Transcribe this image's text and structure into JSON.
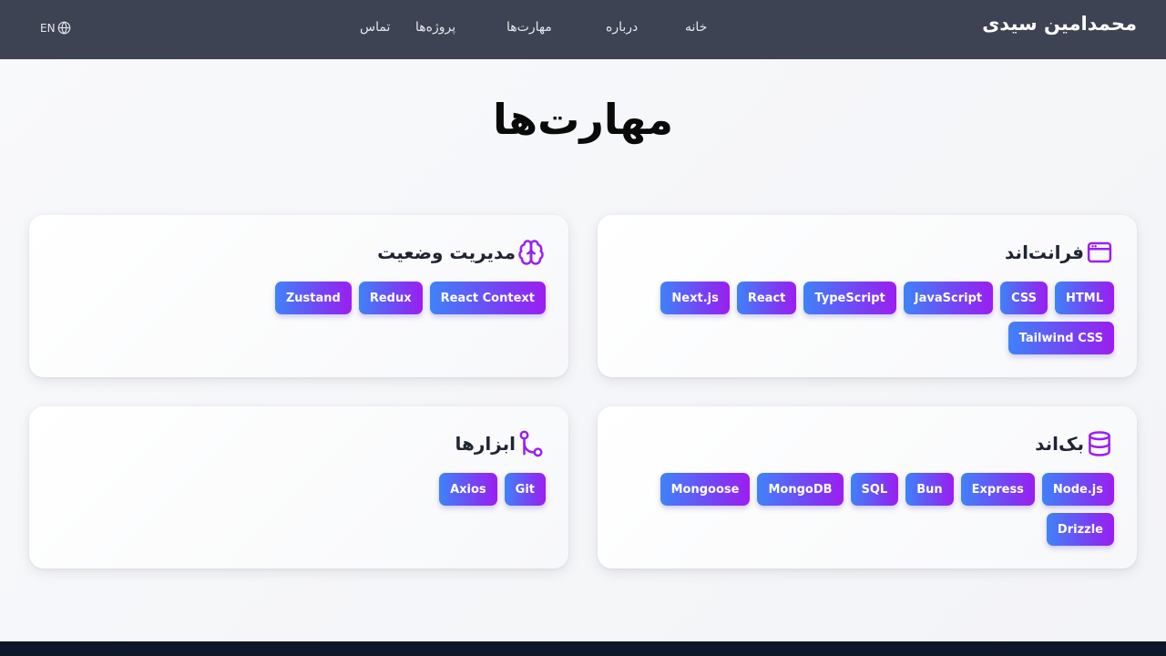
{
  "header": {
    "brand": "محمدامین سیدی",
    "nav": [
      "خانه",
      "درباره",
      "مهارت‌ها",
      "پروژه‌ها",
      "تماس"
    ],
    "lang_label": "EN",
    "lang_icon": "globe-icon"
  },
  "page_title": "مهارت‌ها",
  "accent_color": "#9b1ff0",
  "chip_gradient": [
    "#3f82f8",
    "#9d1ef0"
  ],
  "cards": [
    {
      "title": "فرانت‌اند",
      "icon": "browser-window-icon",
      "skills": [
        "HTML",
        "CSS",
        "JavaScript",
        "TypeScript",
        "React",
        "Next.js",
        "Tailwind CSS"
      ]
    },
    {
      "title": "مدیریت وضعیت",
      "icon": "brain-icon",
      "skills": [
        "React Context",
        "Redux",
        "Zustand"
      ]
    },
    {
      "title": "بک‌اند",
      "icon": "database-icon",
      "skills": [
        "Node.js",
        "Express",
        "Bun",
        "SQL",
        "MongoDB",
        "Mongoose",
        "Drizzle"
      ]
    },
    {
      "title": "ابزارها",
      "icon": "git-branch-icon",
      "skills": [
        "Git",
        "Axios"
      ]
    }
  ]
}
